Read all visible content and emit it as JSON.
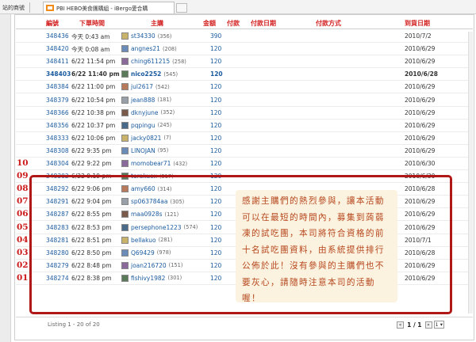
{
  "browser": {
    "left_tab_label": "站的商號",
    "active_tab_title": "PBI HEBO美食團購組 - iBergo愛合購",
    "new_tab_label": ""
  },
  "table": {
    "headers": {
      "id": "編號",
      "order_time": "下單時間",
      "buyer": "主購",
      "amount": "金額",
      "paid": "付款",
      "pay_date": "付款日期",
      "pay_method": "付款方式",
      "deadline": "到貨日期"
    },
    "rows": [
      {
        "id": "348436",
        "date": "今天",
        "time": "0:43 am",
        "buyer": "st34330",
        "score": "(356)",
        "amount": "390",
        "deadline": "2010/7/2",
        "bold": false,
        "rank": ""
      },
      {
        "id": "348420",
        "date": "今天",
        "time": "0:08 am",
        "buyer": "angnes21",
        "score": "(208)",
        "amount": "120",
        "deadline": "2010/6/29",
        "bold": false,
        "rank": ""
      },
      {
        "id": "348411",
        "date": "6/22",
        "time": "11:54 pm",
        "buyer": "ching611215",
        "score": "(258)",
        "amount": "120",
        "deadline": "2010/6/29",
        "bold": false,
        "rank": ""
      },
      {
        "id": "348403",
        "date": "6/22",
        "time": "11:40 pm",
        "buyer": "nico2252",
        "score": "(545)",
        "amount": "120",
        "deadline": "2010/6/28",
        "bold": true,
        "rank": ""
      },
      {
        "id": "348384",
        "date": "6/22",
        "time": "11:00 pm",
        "buyer": "jul2617",
        "score": "(542)",
        "amount": "120",
        "deadline": "2010/6/29",
        "bold": false,
        "rank": ""
      },
      {
        "id": "348379",
        "date": "6/22",
        "time": "10:54 pm",
        "buyer": "jean888",
        "score": "(181)",
        "amount": "120",
        "deadline": "2010/6/29",
        "bold": false,
        "rank": ""
      },
      {
        "id": "348366",
        "date": "6/22",
        "time": "10:38 pm",
        "buyer": "dknyjune",
        "score": "(352)",
        "amount": "120",
        "deadline": "2010/6/29",
        "bold": false,
        "rank": ""
      },
      {
        "id": "348356",
        "date": "6/22",
        "time": "10:37 pm",
        "buyer": "pqpingu",
        "score": "(245)",
        "amount": "120",
        "deadline": "2010/6/29",
        "bold": false,
        "rank": ""
      },
      {
        "id": "348333",
        "date": "6/22",
        "time": "10:06 pm",
        "buyer": "jacky0821",
        "score": "(7)",
        "amount": "120",
        "deadline": "2010/6/29",
        "bold": false,
        "rank": ""
      },
      {
        "id": "348308",
        "date": "6/22",
        "time": "9:35 pm",
        "buyer": "LINOJAN",
        "score": "(95)",
        "amount": "120",
        "deadline": "2010/6/29",
        "bold": false,
        "rank": ""
      },
      {
        "id": "348304",
        "date": "6/22",
        "time": "9:22 pm",
        "buyer": "momobear71",
        "score": "(432)",
        "amount": "120",
        "deadline": "2010/6/30",
        "bold": false,
        "rank": "10"
      },
      {
        "id": "348302",
        "date": "6/22",
        "time": "9:19 pm",
        "buyer": "terakuox",
        "score": "(517)",
        "amount": "120",
        "deadline": "2010/6/30",
        "bold": false,
        "rank": "09"
      },
      {
        "id": "348292",
        "date": "6/22",
        "time": "9:06 pm",
        "buyer": "amy660",
        "score": "(314)",
        "amount": "120",
        "deadline": "2010/6/28",
        "bold": false,
        "rank": "08"
      },
      {
        "id": "348291",
        "date": "6/22",
        "time": "9:04 pm",
        "buyer": "sp063784aa",
        "score": "(305)",
        "amount": "120",
        "deadline": "2010/6/29",
        "bold": false,
        "rank": "07"
      },
      {
        "id": "348287",
        "date": "6/22",
        "time": "8:55 pm",
        "buyer": "maa0928s",
        "score": "(121)",
        "amount": "120",
        "deadline": "2010/6/29",
        "bold": false,
        "rank": "06"
      },
      {
        "id": "348283",
        "date": "6/22",
        "time": "8:53 pm",
        "buyer": "persephone1223",
        "score": "(574)",
        "amount": "120",
        "deadline": "2010/6/29",
        "bold": false,
        "rank": "05"
      },
      {
        "id": "348281",
        "date": "6/22",
        "time": "8:51 pm",
        "buyer": "bellakuo",
        "score": "(281)",
        "amount": "120",
        "deadline": "2010/7/1",
        "bold": false,
        "rank": "04"
      },
      {
        "id": "348280",
        "date": "6/22",
        "time": "8:50 pm",
        "buyer": "Q69429",
        "score": "(978)",
        "amount": "120",
        "deadline": "2010/6/28",
        "bold": false,
        "rank": "03"
      },
      {
        "id": "348279",
        "date": "6/22",
        "time": "8:48 pm",
        "buyer": "joan216720",
        "score": "(151)",
        "amount": "120",
        "deadline": "2010/6/29",
        "bold": false,
        "rank": "02"
      },
      {
        "id": "348274",
        "date": "6/22",
        "time": "8:38 pm",
        "buyer": "fishivy1982",
        "score": "(301)",
        "amount": "120",
        "deadline": "2010/6/29",
        "bold": false,
        "rank": "01"
      }
    ]
  },
  "notice_text": "感謝主購們的熱烈參與，讓本活動可以在最短的時間內，募集到蒟蒻凍的試吃團，本司將符合資格的前十名試吃團資料，由系統提供排行公佈於此！沒有參與的主購們也不要灰心，請隨時注意本司的活動喔！",
  "footer": {
    "listing": "Listing 1 - 20 of 20",
    "page_indicator": "1 / 1",
    "page_select": "1"
  },
  "colors": {
    "header_text": "#d32020",
    "link": "#1a5a9e",
    "highlight_border": "#b01818",
    "notice_bg": "#fbf3df",
    "notice_text": "#b6461e",
    "rank_text": "#cc1a1a"
  }
}
